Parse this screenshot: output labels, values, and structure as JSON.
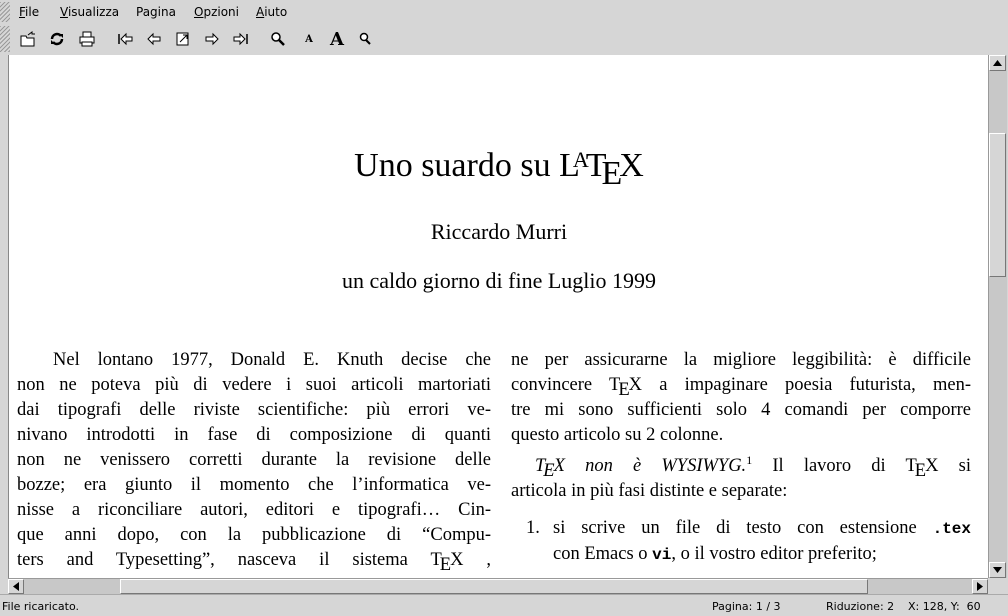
{
  "menubar": {
    "items": [
      {
        "accel": "F",
        "rest": "ile"
      },
      {
        "accel": "V",
        "rest": "isualizza"
      },
      {
        "accel": "",
        "rest": "Pagina"
      },
      {
        "accel": "O",
        "rest": "pzioni"
      },
      {
        "accel": "A",
        "rest": "iuto"
      }
    ]
  },
  "toolbar": {
    "icons": [
      "open-icon",
      "reload-icon",
      "print-icon",
      "first-page-icon",
      "prev-page-icon",
      "goto-page-icon",
      "next-page-icon",
      "last-page-icon",
      "zoom-icon",
      "font-small-icon",
      "font-large-icon",
      "find-icon"
    ],
    "font_small_glyph": "A",
    "font_large_glyph": "A"
  },
  "document": {
    "title_pre": "Uno suardo su L",
    "title_a": "A",
    "title_t": "T",
    "title_e": "E",
    "title_x": "X",
    "author": "Riccardo Murri",
    "date": "un caldo giorno di fine Luglio 1999",
    "left_lines": [
      "Nel lontano 1977, Donald E. Knuth decise che",
      "non ne poteva più di vedere i suoi articoli martoriati",
      "dai tipografi delle riviste scientifiche: più errori ve-",
      "nivano introdotti in fase di composizione di quanti",
      "non ne venissero corretti durante la revisione delle",
      "bozze; era giunto il momento che l’informatica ve-",
      "nisse a riconciliare autori, editori e tipografi… Cin-",
      "que anni dopo, con la pubblicazione di “Compu-",
      "ters and Typesetting”, nasceva il sistema "
    ],
    "left_tex_suffix": " ,",
    "right_lines": [
      "ne per assicurarne la migliore leggibilità: è difficile",
      "mentre mi sono sufficienti solo 4 comandi per comporre",
      "questo articolo su 2 colonne."
    ],
    "right_line2_pre": "convincere ",
    "right_line2_post": " a impaginare poesia futurista, men-",
    "right_line3": "tre mi sono sufficienti solo 4 comandi per comporre",
    "para2_italic_rest": " non è WYSIWYG.",
    "footnote_mark": "1",
    "para2_mid": " Il lavoro di ",
    "para2_end": " si",
    "para2_line2": "articola in più fasi distinte e separate:",
    "list_num": "1.",
    "list_l1_pre": "si scrive un file di testo con estensione ",
    "list_l1_code": ".tex",
    "list_l2_pre": "con Emacs o ",
    "list_l2_code": "vi",
    "list_l2_post": ", o il vostro editor preferito;"
  },
  "status": {
    "message": "File ricaricato.",
    "page": "Pagina: 1 / 3",
    "zoom": "Riduzione: 2",
    "coords": "X: 128, Y:  60"
  }
}
